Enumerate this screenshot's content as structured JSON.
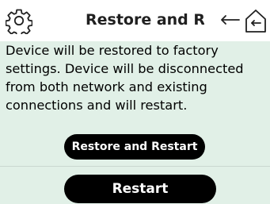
{
  "header": {
    "title": "Restore and R",
    "icons": {
      "settings": "gear-icon",
      "back": "back-arrow-icon",
      "home": "home-icon"
    }
  },
  "main": {
    "message": "Device will be restored to factory settings. Device will be disconnected from both network and existing connections and will restart."
  },
  "buttons": {
    "restore_and_restart": "Restore and Restart",
    "restart": "Restart"
  },
  "colors": {
    "background": "#e1f0e7",
    "header": "#ffffff",
    "button": "#000000",
    "button_text": "#ffffff",
    "text": "#000000"
  }
}
